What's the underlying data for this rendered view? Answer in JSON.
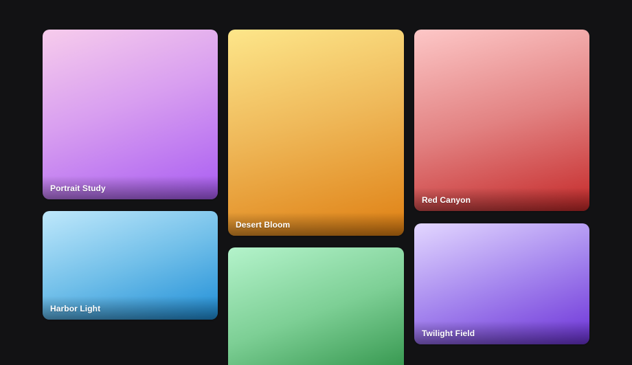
{
  "gallery": {
    "cards": [
      {
        "title": "Portrait Study"
      },
      {
        "title": "Desert Bloom"
      },
      {
        "title": "Red Canyon"
      },
      {
        "title": "Harbor Light"
      },
      {
        "title": ""
      },
      {
        "title": "Twilight Field"
      }
    ]
  },
  "colors": {
    "background": "#121214",
    "portrait_study": [
      "#f7ccec",
      "#a95cf2"
    ],
    "desert_bloom": [
      "#fde68a",
      "#df7f12"
    ],
    "red_canyon": [
      "#fdc7c7",
      "#c52929"
    ],
    "harbor_light": [
      "#bfe8fb",
      "#1f8ed7"
    ],
    "green_card": [
      "#b4f3cb",
      "#2f9248"
    ],
    "twilight_field": [
      "#e3d7ff",
      "#6d33d8"
    ]
  }
}
